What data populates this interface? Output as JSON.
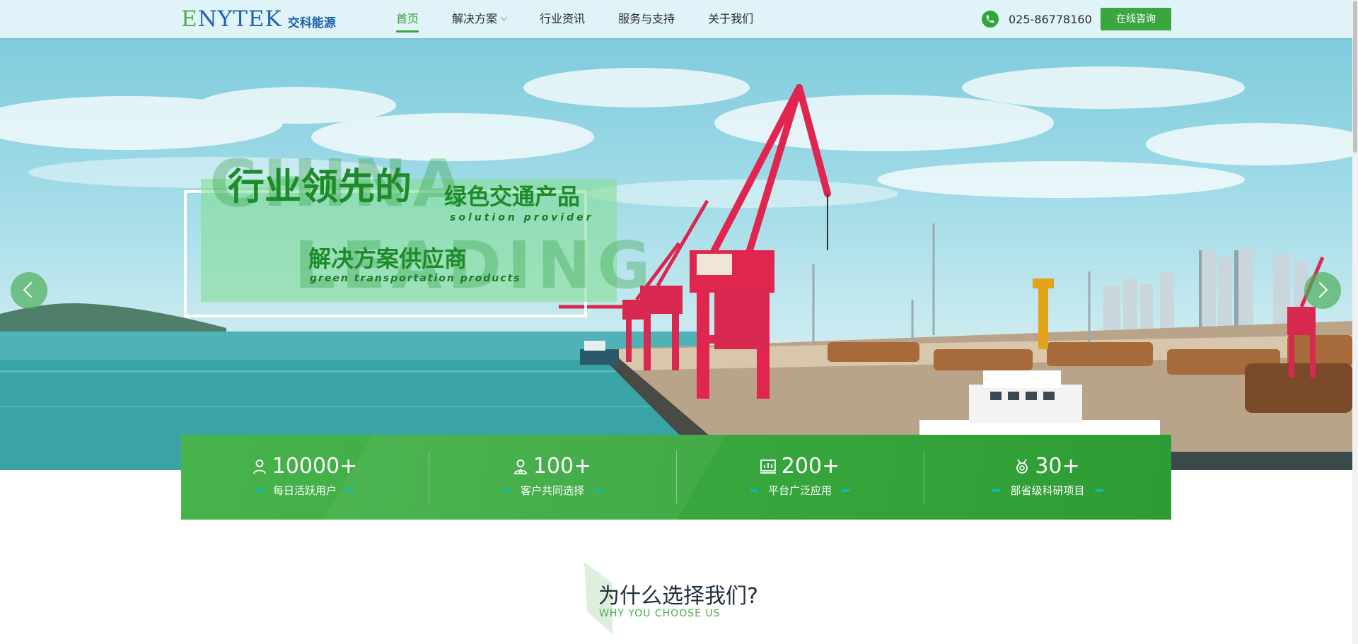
{
  "header": {
    "logo_brand_part1": "E",
    "logo_brand_part2": "NYTEK",
    "logo_sub": "交科能源",
    "nav": [
      {
        "label": "首页",
        "active": true
      },
      {
        "label": "解决方案",
        "has_dropdown": true
      },
      {
        "label": "行业资讯"
      },
      {
        "label": "服务与支持"
      },
      {
        "label": "关于我们"
      }
    ],
    "phone_icon": "phone-icon",
    "phone": "025-86778160",
    "consult_button": "在线咨询"
  },
  "hero": {
    "ghost_word1": "CHINA",
    "ghost_word2": "LEADING",
    "title_main": "行业领先的",
    "title_secondary": "绿色交通产品",
    "subtitle_en1": "solution provider",
    "title_third": "解决方案供应商",
    "subtitle_en2": "green transportation products",
    "prev_icon": "chevron-left-icon",
    "next_icon": "chevron-right-icon",
    "slides_count": 2,
    "active_slide": 1
  },
  "stats": [
    {
      "icon": "user-icon",
      "value": "10000+",
      "label": "每日活跃用户"
    },
    {
      "icon": "customer-icon",
      "value": "100+",
      "label": "客户共同选择"
    },
    {
      "icon": "bar-chart-icon",
      "value": "200+",
      "label": "平台广泛应用"
    },
    {
      "icon": "medal-icon",
      "value": "30+",
      "label": "部省级科研项目"
    }
  ],
  "why": {
    "title": "为什么选择我们?",
    "subtitle": "WHY YOU CHOOSE US"
  },
  "colors": {
    "brand_green": "#3ba53f",
    "brand_blue": "#1e63a9",
    "accent_teal": "#14b8a6"
  }
}
